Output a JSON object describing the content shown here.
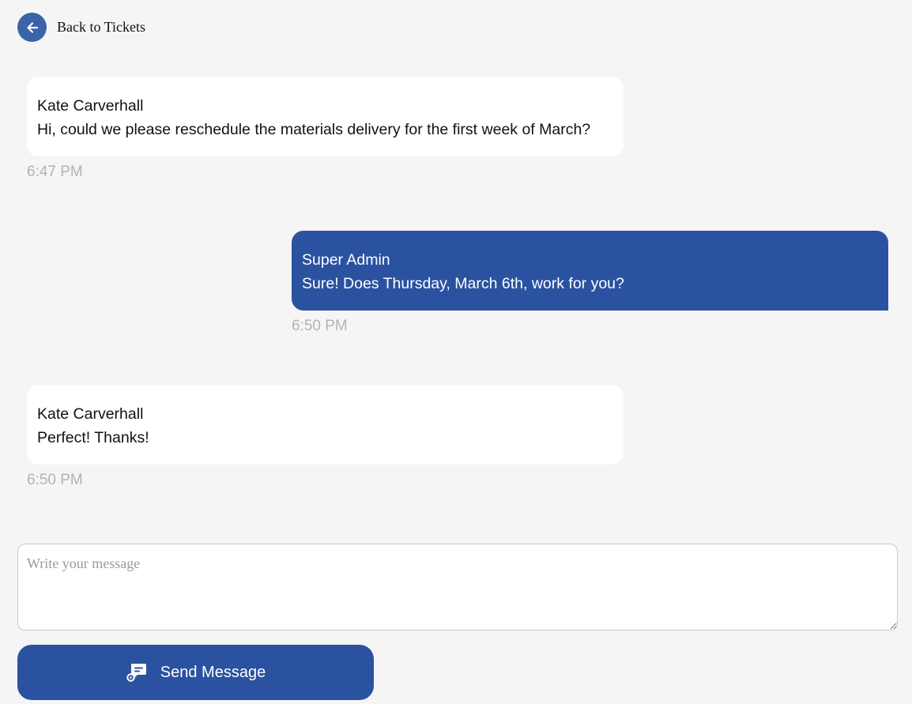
{
  "nav": {
    "back_label": "Back to Tickets"
  },
  "messages": [
    {
      "sender": "Kate Carverhall",
      "text": "Hi, could we please reschedule the materials delivery for the first week of March?",
      "time": "6:47 PM",
      "direction": "incoming"
    },
    {
      "sender": "Super Admin",
      "text": "Sure! Does Thursday, March 6th, work for you?",
      "time": "6:50 PM",
      "direction": "outgoing"
    },
    {
      "sender": "Kate Carverhall",
      "text": "Perfect! Thanks!",
      "time": "6:50 PM",
      "direction": "incoming"
    }
  ],
  "composer": {
    "placeholder": "Write your message",
    "value": ""
  },
  "send_button": {
    "label": "Send Message",
    "icon": "send-message-icon"
  },
  "colors": {
    "accent": "#2a52a0",
    "back_icon_bg": "#3b63a8",
    "background": "#f5f5f5",
    "incoming_bubble": "#ffffff",
    "timestamp": "#b3b3b3"
  }
}
